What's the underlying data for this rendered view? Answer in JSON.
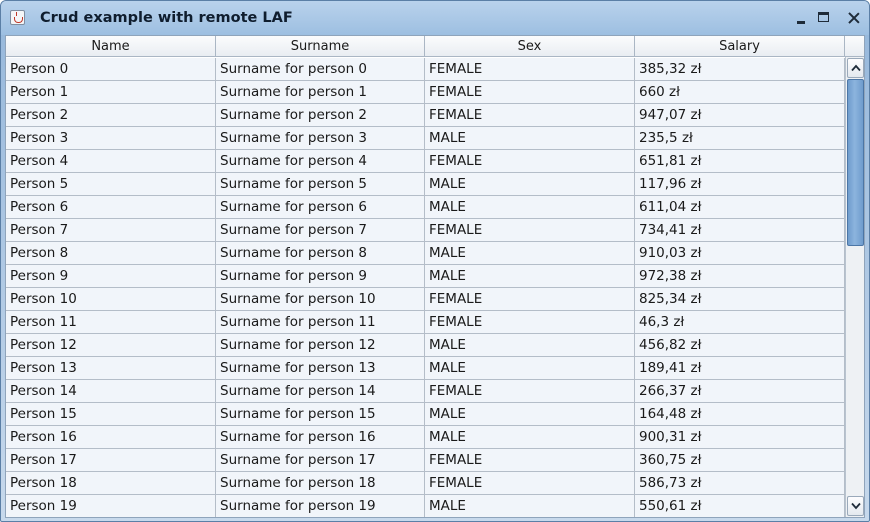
{
  "window": {
    "title": "Crud example with remote LAF",
    "icon": "java-app-icon",
    "controls": [
      "minimize-icon",
      "maximize-icon",
      "close-icon"
    ]
  },
  "table": {
    "columns": [
      "Name",
      "Surname",
      "Sex",
      "Salary"
    ],
    "rows": [
      [
        "Person 0",
        "Surname for person 0",
        "FEMALE",
        "385,32 zł"
      ],
      [
        "Person 1",
        "Surname for person 1",
        "FEMALE",
        "660 zł"
      ],
      [
        "Person 2",
        "Surname for person 2",
        "FEMALE",
        "947,07 zł"
      ],
      [
        "Person 3",
        "Surname for person 3",
        "MALE",
        "235,5 zł"
      ],
      [
        "Person 4",
        "Surname for person 4",
        "FEMALE",
        "651,81 zł"
      ],
      [
        "Person 5",
        "Surname for person 5",
        "MALE",
        "117,96 zł"
      ],
      [
        "Person 6",
        "Surname for person 6",
        "MALE",
        "611,04 zł"
      ],
      [
        "Person 7",
        "Surname for person 7",
        "FEMALE",
        "734,41 zł"
      ],
      [
        "Person 8",
        "Surname for person 8",
        "MALE",
        "910,03 zł"
      ],
      [
        "Person 9",
        "Surname for person 9",
        "MALE",
        "972,38 zł"
      ],
      [
        "Person 10",
        "Surname for person 10",
        "FEMALE",
        "825,34 zł"
      ],
      [
        "Person 11",
        "Surname for person 11",
        "FEMALE",
        "46,3 zł"
      ],
      [
        "Person 12",
        "Surname for person 12",
        "MALE",
        "456,82 zł"
      ],
      [
        "Person 13",
        "Surname for person 13",
        "MALE",
        "189,41 zł"
      ],
      [
        "Person 14",
        "Surname for person 14",
        "FEMALE",
        "266,37 zł"
      ],
      [
        "Person 15",
        "Surname for person 15",
        "MALE",
        "164,48 zł"
      ],
      [
        "Person 16",
        "Surname for person 16",
        "MALE",
        "900,31 zł"
      ],
      [
        "Person 17",
        "Surname for person 17",
        "FEMALE",
        "360,75 zł"
      ],
      [
        "Person 18",
        "Surname for person 18",
        "FEMALE",
        "586,73 zł"
      ],
      [
        "Person 19",
        "Surname for person 19",
        "MALE",
        "550,61 zł"
      ]
    ]
  },
  "scrollbar": {
    "up_icon": "chevron-up-icon",
    "down_icon": "chevron-down-icon",
    "position_fraction": 0.0,
    "visible_fraction": 0.4
  },
  "colors": {
    "titlebar": "#a9c7e6",
    "row_background": "#f1f5fa",
    "grid_line": "#b4bdc8",
    "scroll_thumb": "#7aa5d4"
  }
}
